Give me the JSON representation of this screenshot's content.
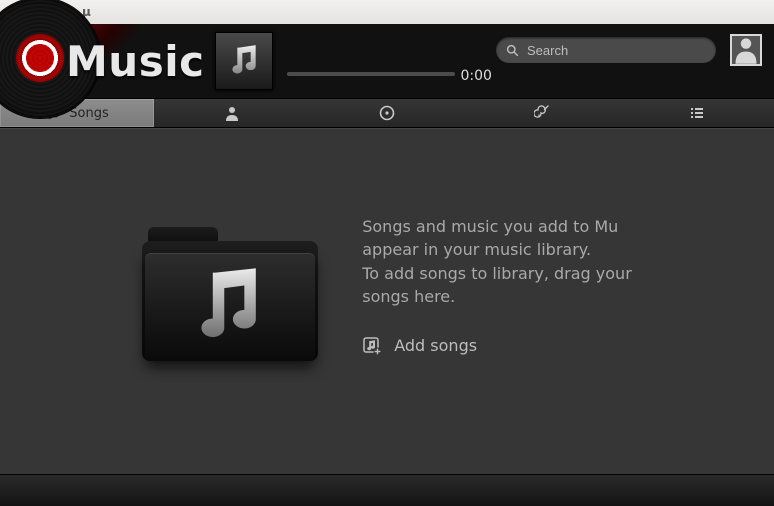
{
  "window": {
    "title": "μ"
  },
  "header": {
    "app_name": "Music",
    "time": "0:00",
    "search_placeholder": "Search"
  },
  "tabs": {
    "songs": "Songs"
  },
  "empty_state": {
    "line1": "Songs and music you add to Mu",
    "line2": "appear in your music library.",
    "line3": "To add songs to library, drag your",
    "line4": "songs here.",
    "add_label": "Add songs"
  }
}
